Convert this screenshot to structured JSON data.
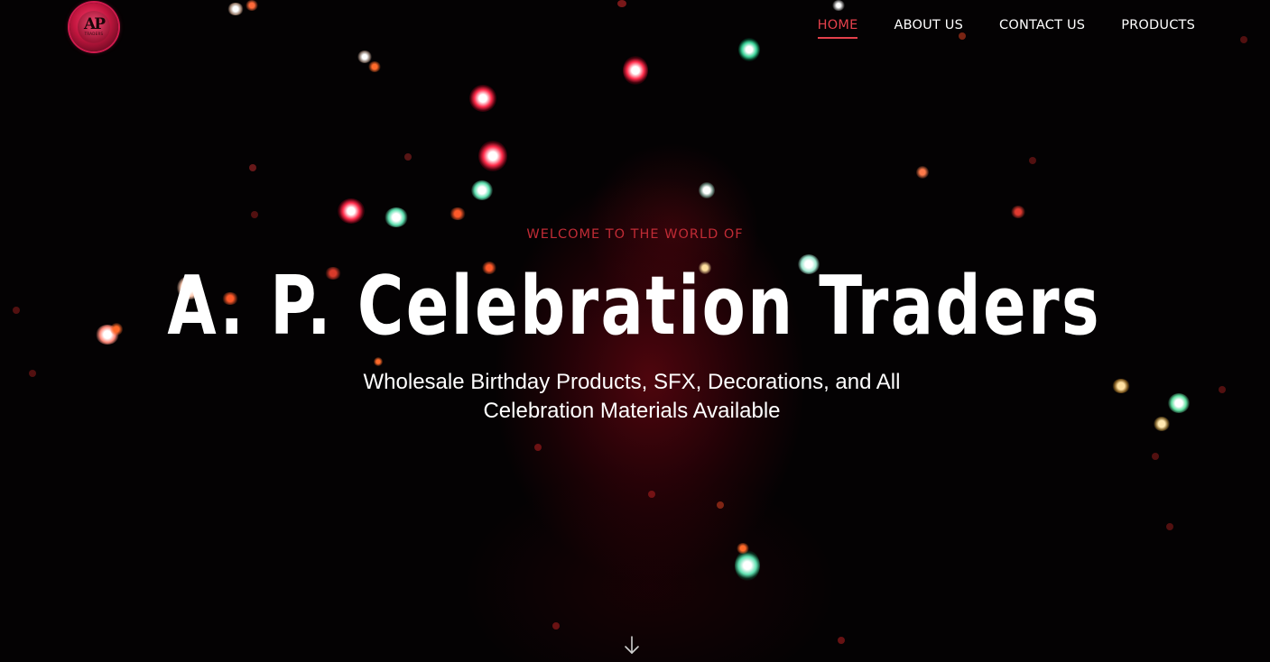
{
  "brand": {
    "logo_mark": "AP",
    "logo_sub": "TRADERS"
  },
  "nav": {
    "items": [
      {
        "label": "HOME",
        "active": true
      },
      {
        "label": "ABOUT US",
        "active": false
      },
      {
        "label": "CONTACT US",
        "active": false
      },
      {
        "label": "PRODUCTS",
        "active": false
      }
    ]
  },
  "hero": {
    "eyebrow": "WELCOME TO THE WORLD OF",
    "title": "A. P. Celebration Traders",
    "subtitle": "Wholesale Birthday Products, SFX, Decorations, and All Celebration Materials Available"
  },
  "colors": {
    "accent": "#e3404b",
    "eyebrow": "#c02b35",
    "background": "#040203",
    "text": "#ffffff"
  },
  "icons": {
    "scroll": "arrow-down-icon"
  }
}
